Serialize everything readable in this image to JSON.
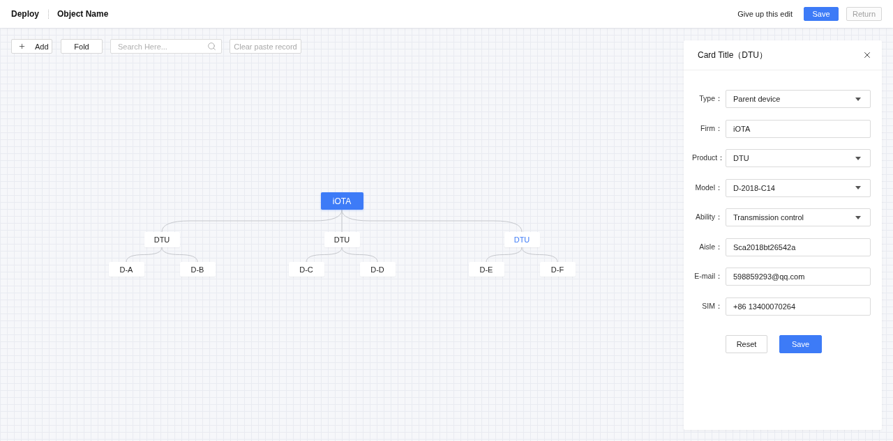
{
  "header": {
    "title": "Deploy",
    "object_name": "Object Name",
    "actions": [
      {
        "label": "Give up this edit",
        "kind": "text",
        "disabled": false
      },
      {
        "label": "Save",
        "kind": "primary",
        "disabled": false
      },
      {
        "label": "Return",
        "kind": "default",
        "disabled": true
      }
    ]
  },
  "toolbar": {
    "add_label": "Add",
    "fold_label": "Fold",
    "search": {
      "placeholder": "Search Here..."
    },
    "clear": {
      "label": "Clear paste record",
      "disabled": true
    }
  },
  "tree": {
    "label": "iOTA",
    "selected": false,
    "children": [
      {
        "label": "DTU",
        "selected": false,
        "children": [
          {
            "label": "D-A",
            "selected": false
          },
          {
            "label": "D-B",
            "selected": false
          }
        ]
      },
      {
        "label": "DTU",
        "selected": false,
        "children": [
          {
            "label": "D-C",
            "selected": false
          },
          {
            "label": "D-D",
            "selected": false
          }
        ]
      },
      {
        "label": "DTU",
        "selected": true,
        "children": [
          {
            "label": "D-E",
            "selected": false
          },
          {
            "label": "D-F",
            "selected": false
          }
        ]
      }
    ]
  },
  "panel": {
    "title": "Card Title（DTU）",
    "fields": [
      {
        "label": "Type：",
        "value": "Parent device",
        "kind": "select"
      },
      {
        "label": "Firm：",
        "value": "iOTA",
        "kind": "input"
      },
      {
        "label": "Product：",
        "value": "DTU",
        "kind": "select"
      },
      {
        "label": "Model：",
        "value": "D-2018-C14",
        "kind": "select"
      },
      {
        "label": "Ability：",
        "value": "Transmission control",
        "kind": "select"
      },
      {
        "label": "Aisle：",
        "value": "Sca2018bt26542a",
        "kind": "input"
      },
      {
        "label": "E-mail：",
        "value": "598859293@qq.com",
        "kind": "input"
      },
      {
        "label": "SIM：",
        "value": "+86 13400070264",
        "kind": "input"
      }
    ],
    "buttons": [
      {
        "label": "Reset",
        "kind": "default"
      },
      {
        "label": "Save",
        "kind": "primary"
      }
    ]
  }
}
